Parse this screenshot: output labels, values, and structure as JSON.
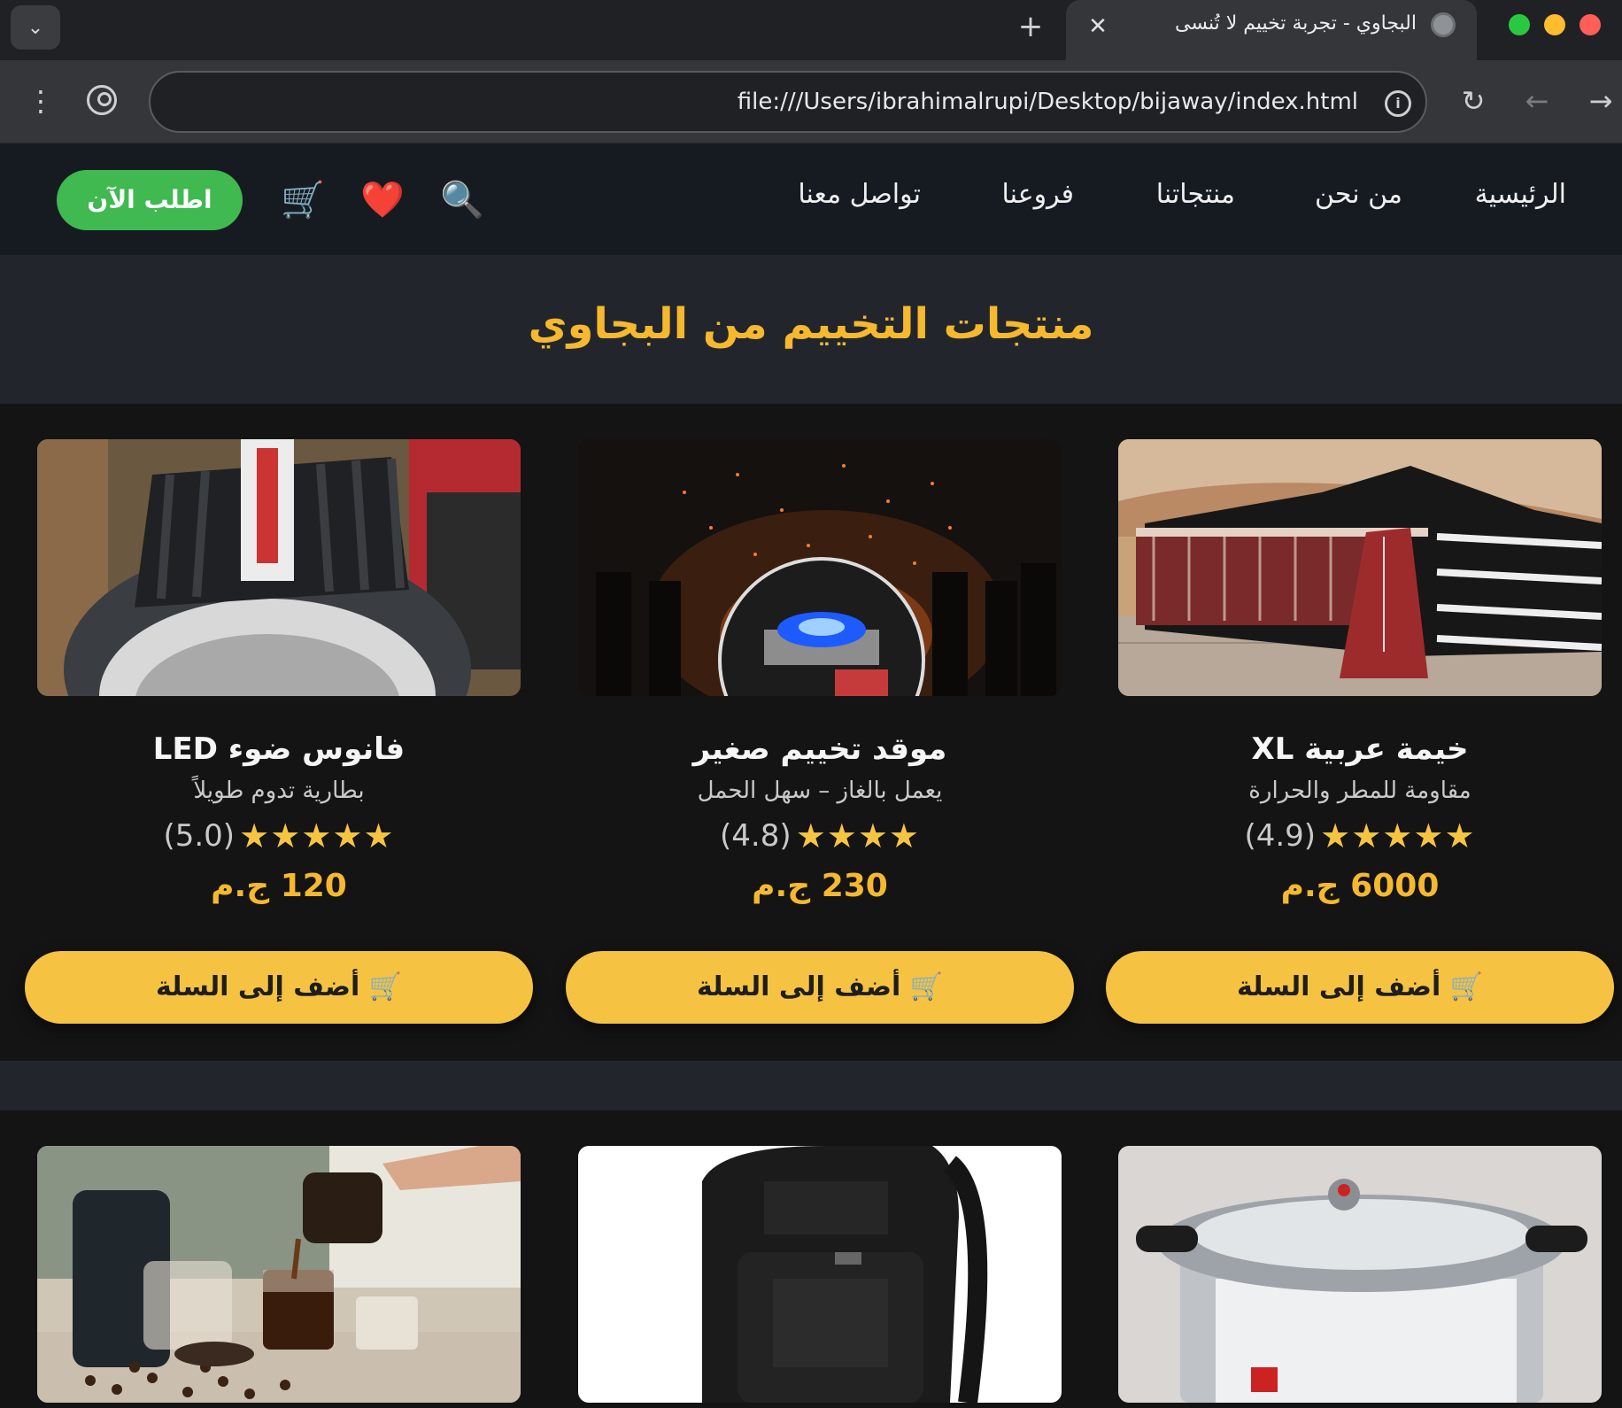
{
  "browser": {
    "tab_title": "البجاوي - تجربة تخييم لا تُنسى",
    "tab_close": "✕",
    "new_tab": "+",
    "url": "file:///Users/ibrahimalrupi/Desktop/bijaway/index.html",
    "traffic_colors": {
      "green": "#2ac840",
      "yellow": "#febc2e",
      "red": "#ff5f57"
    }
  },
  "header": {
    "order_now": "اطلب الآن",
    "icons": {
      "cart": "🛒",
      "favorites": "❤️",
      "search": "🔍"
    },
    "nav": [
      "الرئيسية",
      "من نحن",
      "منتجاتنا",
      "فروعنا",
      "تواصل معنا"
    ]
  },
  "page": {
    "title": "منتجات التخييم من البجاوي"
  },
  "products": [
    {
      "name": "خيمة عربية XL",
      "desc": "مقاومة للمطر والحرارة",
      "stars": "★★★★★",
      "rating": "(4.9)",
      "price": "6000 ج.م",
      "add_label": "🛒 أضف إلى السلة",
      "image": "arabic-tent-photo"
    },
    {
      "name": "موقد تخييم صغير",
      "desc": "يعمل بالغاز – سهل الحمل",
      "stars": "★★★★",
      "rating": "(4.8)",
      "price": "230 ج.م",
      "add_label": "🛒 أضف إلى السلة",
      "image": "campfire-stove-photo"
    },
    {
      "name": "فانوس ضوء LED",
      "desc": "بطارية تدوم طويلاً",
      "stars": "★★★★★",
      "rating": "(5.0)",
      "price": "120 ج.م",
      "add_label": "🛒 أضف إلى السلة",
      "image": "led-lantern-photo"
    },
    {
      "image": "pressure-cooker-photo"
    },
    {
      "image": "black-backpack-photo"
    },
    {
      "image": "coffee-pouring-photo"
    }
  ],
  "colors": {
    "accent": "#f5b82e",
    "order_button": "#3fb950",
    "header_bg": "#161b22"
  }
}
